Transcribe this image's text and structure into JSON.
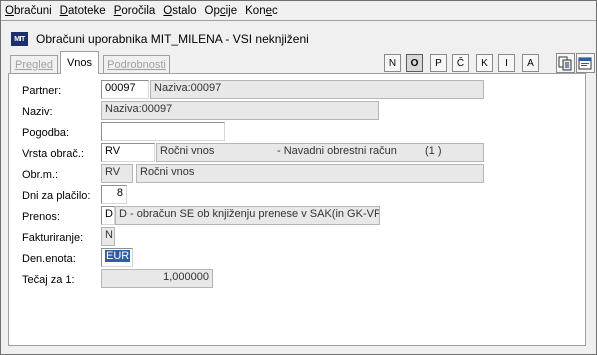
{
  "menu": {
    "items": [
      {
        "pre": "",
        "key": "O",
        "post": "bračuni"
      },
      {
        "pre": "",
        "key": "D",
        "post": "atoteke"
      },
      {
        "pre": "",
        "key": "P",
        "post": "oročila"
      },
      {
        "pre": "",
        "key": "O",
        "post": "stalo"
      },
      {
        "pre": "Op",
        "key": "c",
        "post": "ije"
      },
      {
        "pre": "Kon",
        "key": "e",
        "post": "c"
      }
    ]
  },
  "window": {
    "logo_text": "MIT",
    "title": "Obračuni uporabnika MIT_MILENA - VSI neknjiženi"
  },
  "tabs": [
    {
      "label": "Pregled"
    },
    {
      "label": "Vnos"
    },
    {
      "label": "Podrobnosti"
    }
  ],
  "toolbar": {
    "letters": [
      "N",
      "O",
      "P",
      "Č",
      "K",
      "I",
      "A"
    ]
  },
  "form": {
    "partner": {
      "label": "Partner:",
      "code": "00097",
      "desc": "Naziva:00097"
    },
    "naziv": {
      "label": "Naziv:",
      "value": "Naziva:00097"
    },
    "pogodba": {
      "label": "Pogodba:",
      "value": ""
    },
    "vrsta": {
      "label": "Vrsta obrač.:",
      "code": "RV",
      "desc": "Ročni vnos",
      "desc2": "- Navadni obrestni račun",
      "desc3": "(1 )"
    },
    "obrm": {
      "label": "Obr.m.:",
      "code": "RV",
      "desc": "Ročni vnos"
    },
    "dni": {
      "label": "Dni za plačilo:",
      "value": "8"
    },
    "prenos": {
      "label": "Prenos:",
      "code": "D",
      "desc": "D - obračun SE ob knjiženju prenese v SAK(in GK-VP)"
    },
    "fakturiranje": {
      "label": "Fakturiranje:",
      "value": "N"
    },
    "denenota": {
      "label": "Den.enota:",
      "value": "EUR"
    },
    "tecaj": {
      "label": "Tečaj za 1:",
      "value": "1,000000"
    }
  }
}
